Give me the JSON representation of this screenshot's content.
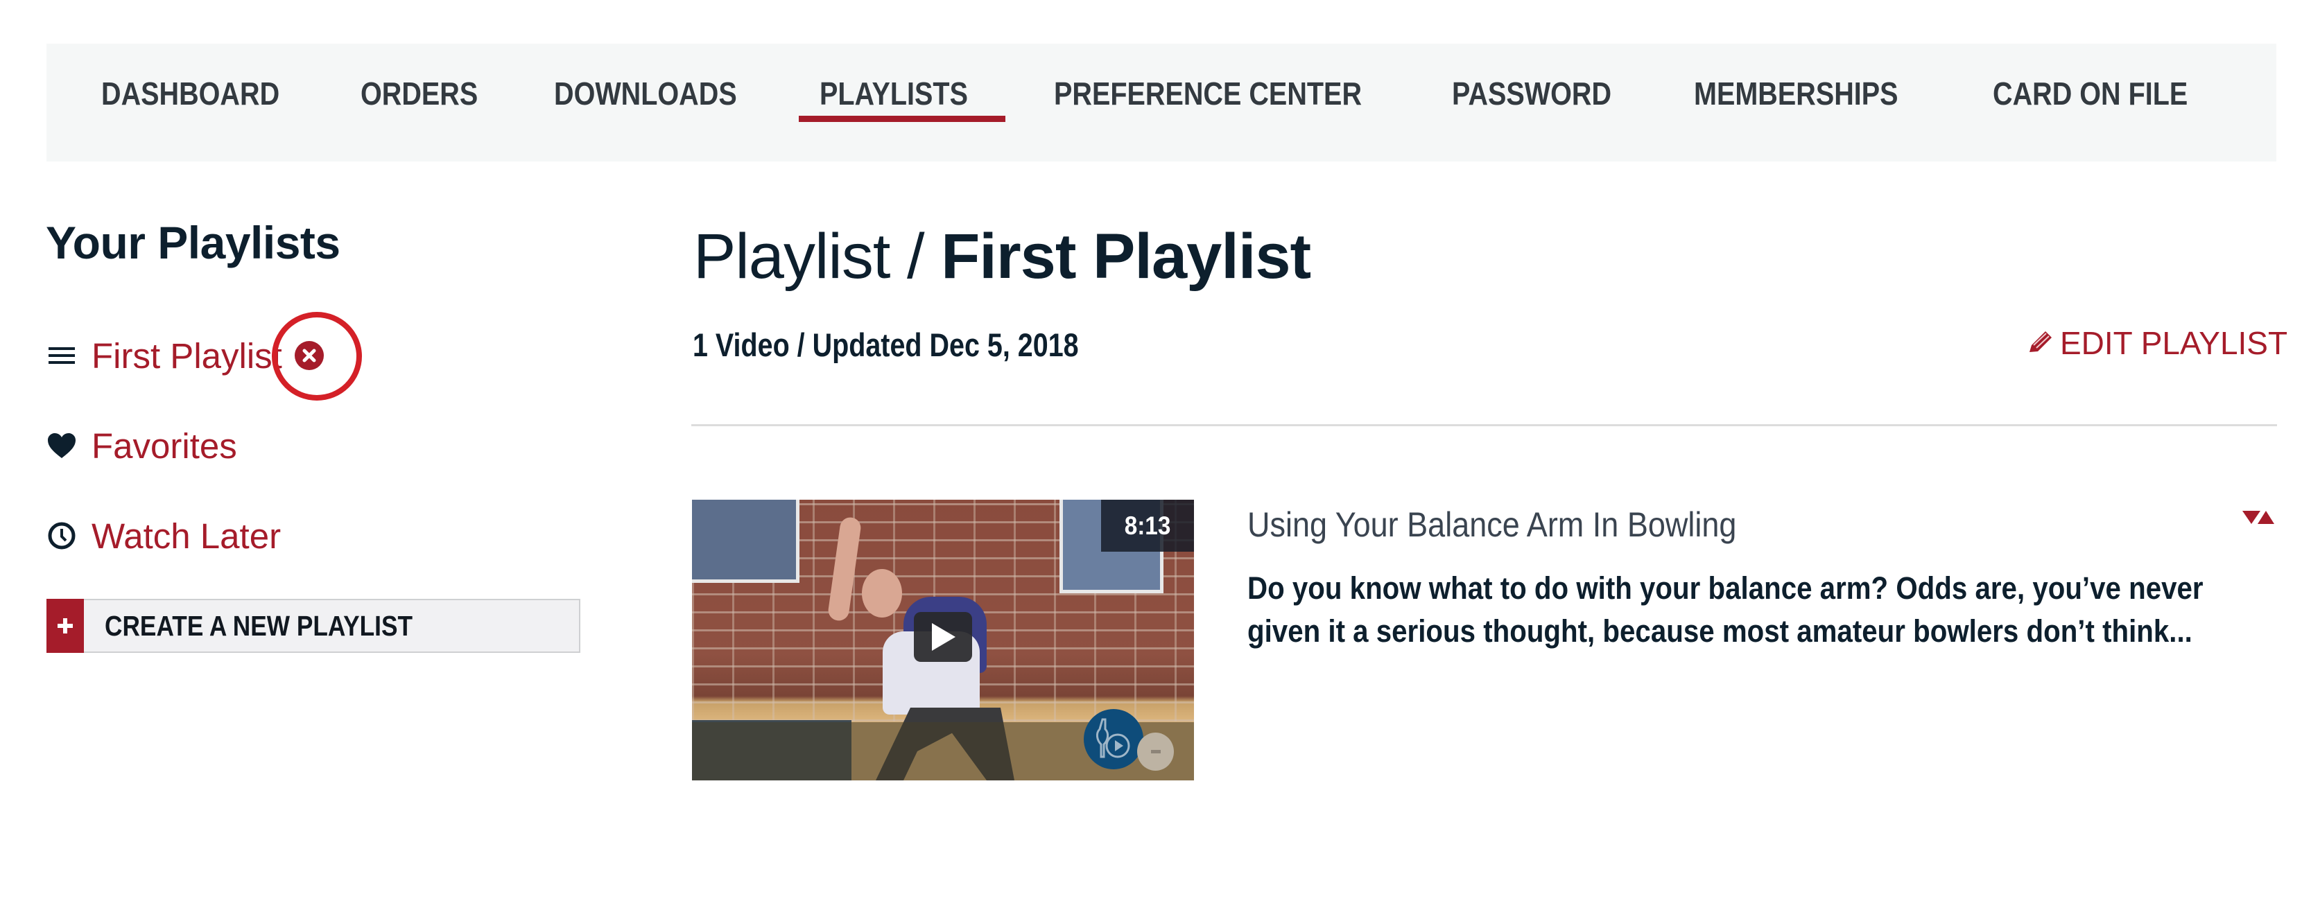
{
  "nav": {
    "items": [
      {
        "label": "DASHBOARD",
        "active": false
      },
      {
        "label": "ORDERS",
        "active": false
      },
      {
        "label": "DOWNLOADS",
        "active": false
      },
      {
        "label": "PLAYLISTS",
        "active": true
      },
      {
        "label": "PREFERENCE CENTER",
        "active": false
      },
      {
        "label": "PASSWORD",
        "active": false
      },
      {
        "label": "MEMBERSHIPS",
        "active": false
      },
      {
        "label": "CARD ON FILE",
        "active": false
      }
    ]
  },
  "sidebar": {
    "title": "Your Playlists",
    "items": [
      {
        "label": "First Playlist",
        "icon": "hamburger-icon",
        "removable": true
      },
      {
        "label": "Favorites",
        "icon": "heart-icon"
      },
      {
        "label": "Watch Later",
        "icon": "clock-icon"
      }
    ],
    "create_button": {
      "icon": "plus-icon",
      "label": "CREATE A NEW PLAYLIST"
    }
  },
  "main": {
    "title_prefix": "Playlist /",
    "title_name": "First Playlist",
    "meta": "1 Video / Updated Dec 5, 2018",
    "edit_label": "EDIT PLAYLIST",
    "edit_icon": "pencil-icon",
    "videos": [
      {
        "title": "Using Your Balance Arm In Bowling",
        "description": "Do you know what to do with your balance arm? Odds are, you’ve never given it a serious thought, because most amateur bowlers don’t think...",
        "duration": "8:13"
      }
    ]
  },
  "colors": {
    "accent": "#a51c2a",
    "text_dark": "#0d1f2d",
    "nav_bg": "#f5f7f7",
    "annotation": "#d42027"
  }
}
